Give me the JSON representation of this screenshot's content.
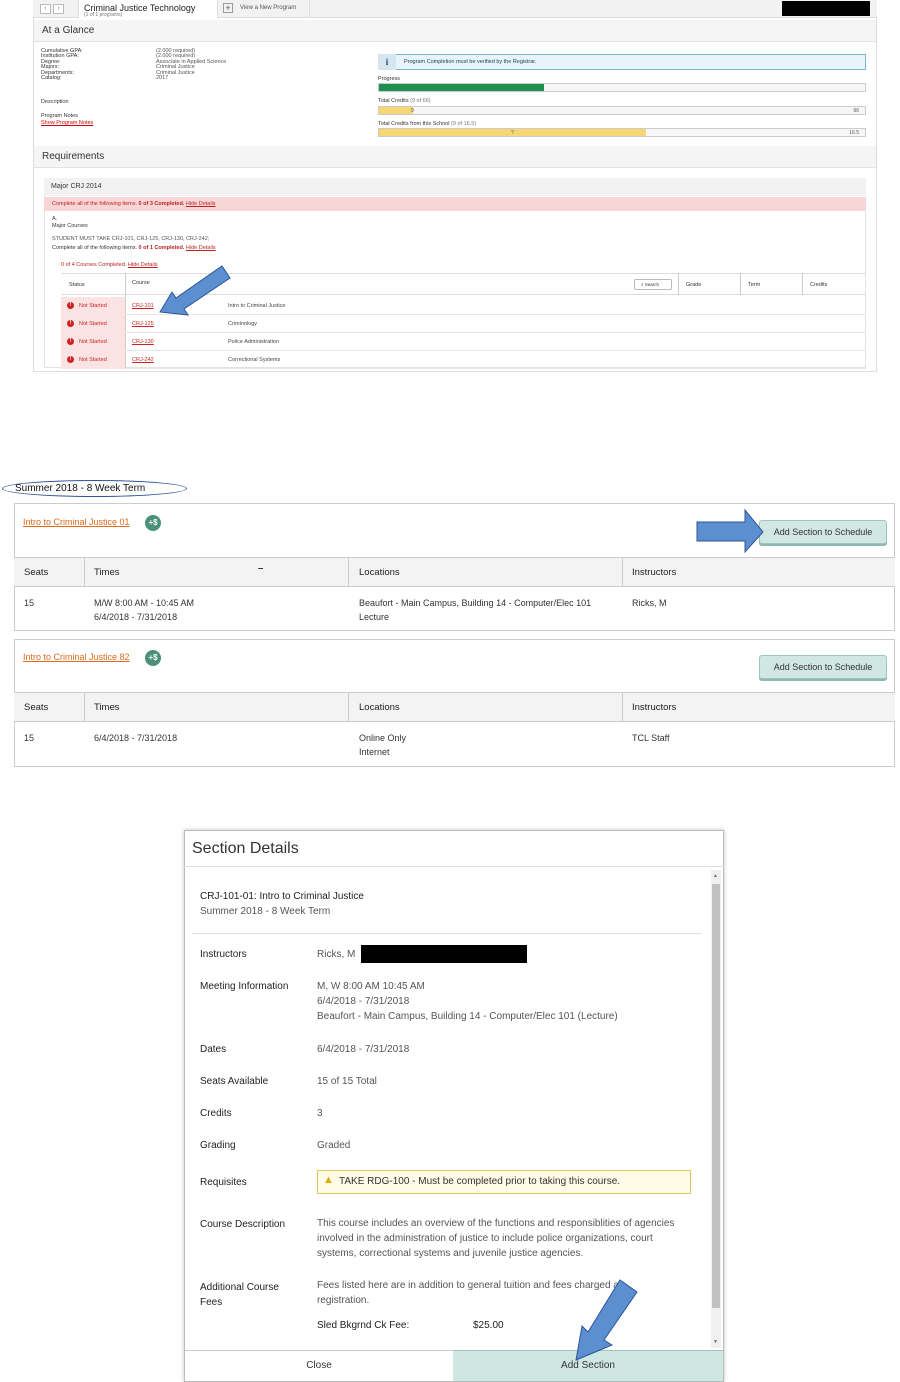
{
  "top": {
    "program_title": "Criminal Justice Technology",
    "program_sub": "(1 of 1 programs)",
    "view_new": "View a New Program",
    "at_a_glance": "At a Glance",
    "glance_labels": [
      "Cumulative GPA:",
      "Institution GPA:",
      "Degree:",
      "Majors:",
      "Departments:",
      "Catalog:"
    ],
    "glance_values": [
      "(2.000 required)",
      "(2.000 required)",
      "Associate in Applied Science",
      "Criminal Justice",
      "Criminal Justice",
      "2017"
    ],
    "description_label": "Description",
    "program_notes_label": "Program Notes",
    "show_notes": "Show Program Notes",
    "info_text": "Program Completion must be verified by the Registrar.",
    "progress_label": "Progress",
    "progress_fraction": 0.34,
    "total_credits_label": "Total Credits",
    "total_credits_sub": "(9 of 66)",
    "total_credits_mark": "9",
    "total_credits_max": "66",
    "total_credits_fraction": 0.07,
    "school_credits_label": "Total Credits from this School",
    "school_credits_sub": "(9 of 16.5)",
    "school_credits_mark": "?",
    "school_credits_max": "16.5",
    "school_credits_fraction": 0.55,
    "requirements": "Requirements",
    "major_heading": "Major CRJ 2014",
    "complete_all": "Complete all of the following items.",
    "complete_count": "0 of 3 Completed.",
    "hide_details": "Hide Details",
    "a_label": "A.",
    "major_courses": "Major Courses",
    "must_take": "STUDENT MUST TAKE CRJ-101, CRJ-125, CRJ-130, CRJ-242;",
    "complete_all2": "Complete all of the following items.",
    "complete_count2": "0 of 1 Completed.",
    "courses_completed": "0 of 4 Courses Completed.",
    "table_headers": {
      "status": "Status",
      "course": "Course",
      "search": "Search",
      "grade": "Grade",
      "term": "Term",
      "credits": "Credits"
    },
    "rows": [
      {
        "status": "Not Started",
        "code": "CRJ-101",
        "title": "Intro to Criminal Justice"
      },
      {
        "status": "Not Started",
        "code": "CRJ-125",
        "title": "Criminology"
      },
      {
        "status": "Not Started",
        "code": "CRJ-130",
        "title": "Police Administration"
      },
      {
        "status": "Not Started",
        "code": "CRJ-242",
        "title": "Correctional Systems"
      }
    ]
  },
  "term": "Summer 2018 - 8 Week Term",
  "sections": [
    {
      "course_link": "Intro to Criminal Justice 01",
      "badge": "+$",
      "add_label": "Add Section to Schedule",
      "headers": {
        "seats": "Seats",
        "times": "Times",
        "times_extra": "–",
        "locations": "Locations",
        "instructors": "Instructors"
      },
      "seats": "15",
      "times_1": "M/W 8:00 AM - 10:45 AM",
      "times_2": "6/4/2018 - 7/31/2018",
      "loc_1": "Beaufort - Main Campus, Building 14 - Computer/Elec 101",
      "loc_2": "Lecture",
      "instructor": "Ricks, M"
    },
    {
      "course_link": "Intro to Criminal Justice 82",
      "badge": "+$",
      "add_label": "Add Section to Schedule",
      "headers": {
        "seats": "Seats",
        "times": "Times",
        "locations": "Locations",
        "instructors": "Instructors"
      },
      "seats": "15",
      "times_1": "6/4/2018 - 7/31/2018",
      "loc_1": "Online Only",
      "loc_2": "Internet",
      "instructor": "TCL Staff"
    }
  ],
  "modal": {
    "title": "Section Details",
    "course": "CRJ-101-01: Intro to Criminal Justice",
    "term": "Summer 2018 - 8 Week Term",
    "labels": {
      "instructors": "Instructors",
      "meeting": "Meeting Information",
      "dates": "Dates",
      "seats": "Seats Available",
      "credits": "Credits",
      "grading": "Grading",
      "requisites": "Requisites",
      "description": "Course Description",
      "fees_1": "Additional Course",
      "fees_2": "Fees"
    },
    "instructor": "Ricks, M",
    "meeting_1": "M, W 8:00 AM 10:45 AM",
    "meeting_2": "6/4/2018 - 7/31/2018",
    "meeting_3": "Beaufort - Main Campus, Building 14 - Computer/Elec 101 (Lecture)",
    "dates": "6/4/2018 - 7/31/2018",
    "seats": "15 of 15 Total",
    "credits": "3",
    "grading": "Graded",
    "requisite": "TAKE RDG-100 - Must be completed prior to taking this course.",
    "desc_1": "This course includes an overview of the functions and responsiblities of agencies",
    "desc_2": "involved in the administration of justice to include police organizations, court",
    "desc_3": "systems, correctional systems and juvenile justice agencies.",
    "fees_text_1": "Fees listed here are in addition to general tuition and fees charged at",
    "fees_text_2": "registration.",
    "fee_name": "Sled Bkgrnd Ck Fee:",
    "fee_amount": "$25.00",
    "close": "Close",
    "add_section": "Add Section"
  },
  "colors": {
    "accent": "#e06a1b",
    "arrow": "#5b8fd0",
    "progress_green": "#1f8f4e",
    "credit_yellow": "#f7d774"
  }
}
